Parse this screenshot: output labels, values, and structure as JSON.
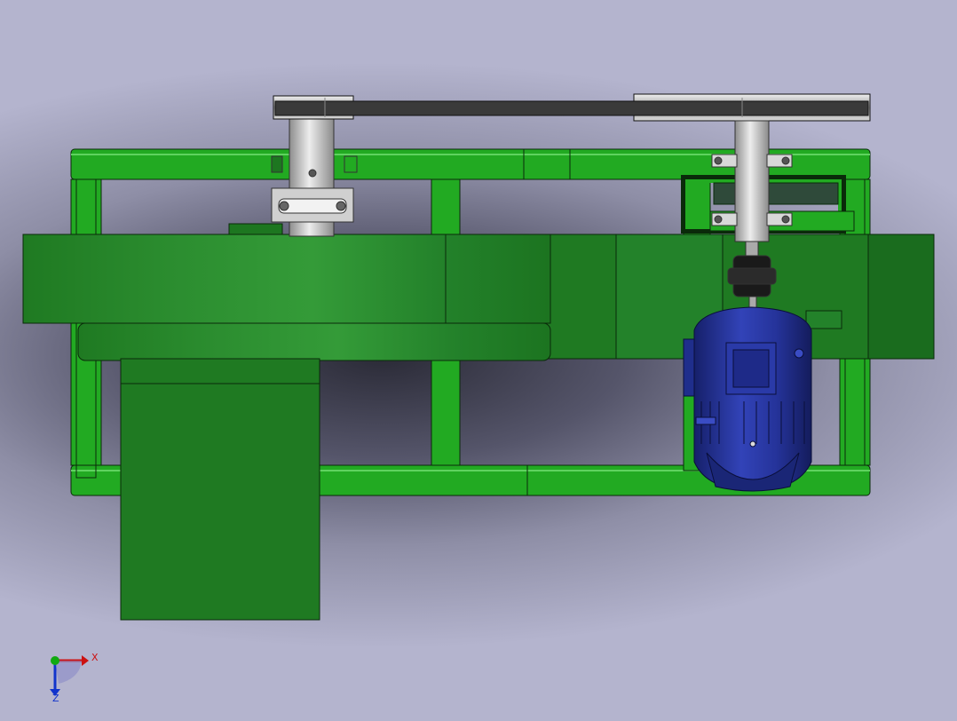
{
  "viewport": {
    "background_top": "#b4b4ce",
    "background_center": "#2a2a36"
  },
  "colors": {
    "frame_green": "#22aa22",
    "frame_green_dark": "#0e7a12",
    "housing_green": "#1f7a22",
    "housing_green_light": "#2f9434",
    "housing_green_dark": "#145c18",
    "motor_blue": "#1f2e8c",
    "motor_blue_light": "#3a4cc4",
    "shaft_silver": "#c4c4c4",
    "belt_dark": "#3a3a3a",
    "outline": "#0a2a0a"
  },
  "triad": {
    "x_label": "X",
    "z_label": "Z",
    "x_color": "#cc1111",
    "z_color": "#1133cc",
    "y_color": "#11aa11"
  }
}
